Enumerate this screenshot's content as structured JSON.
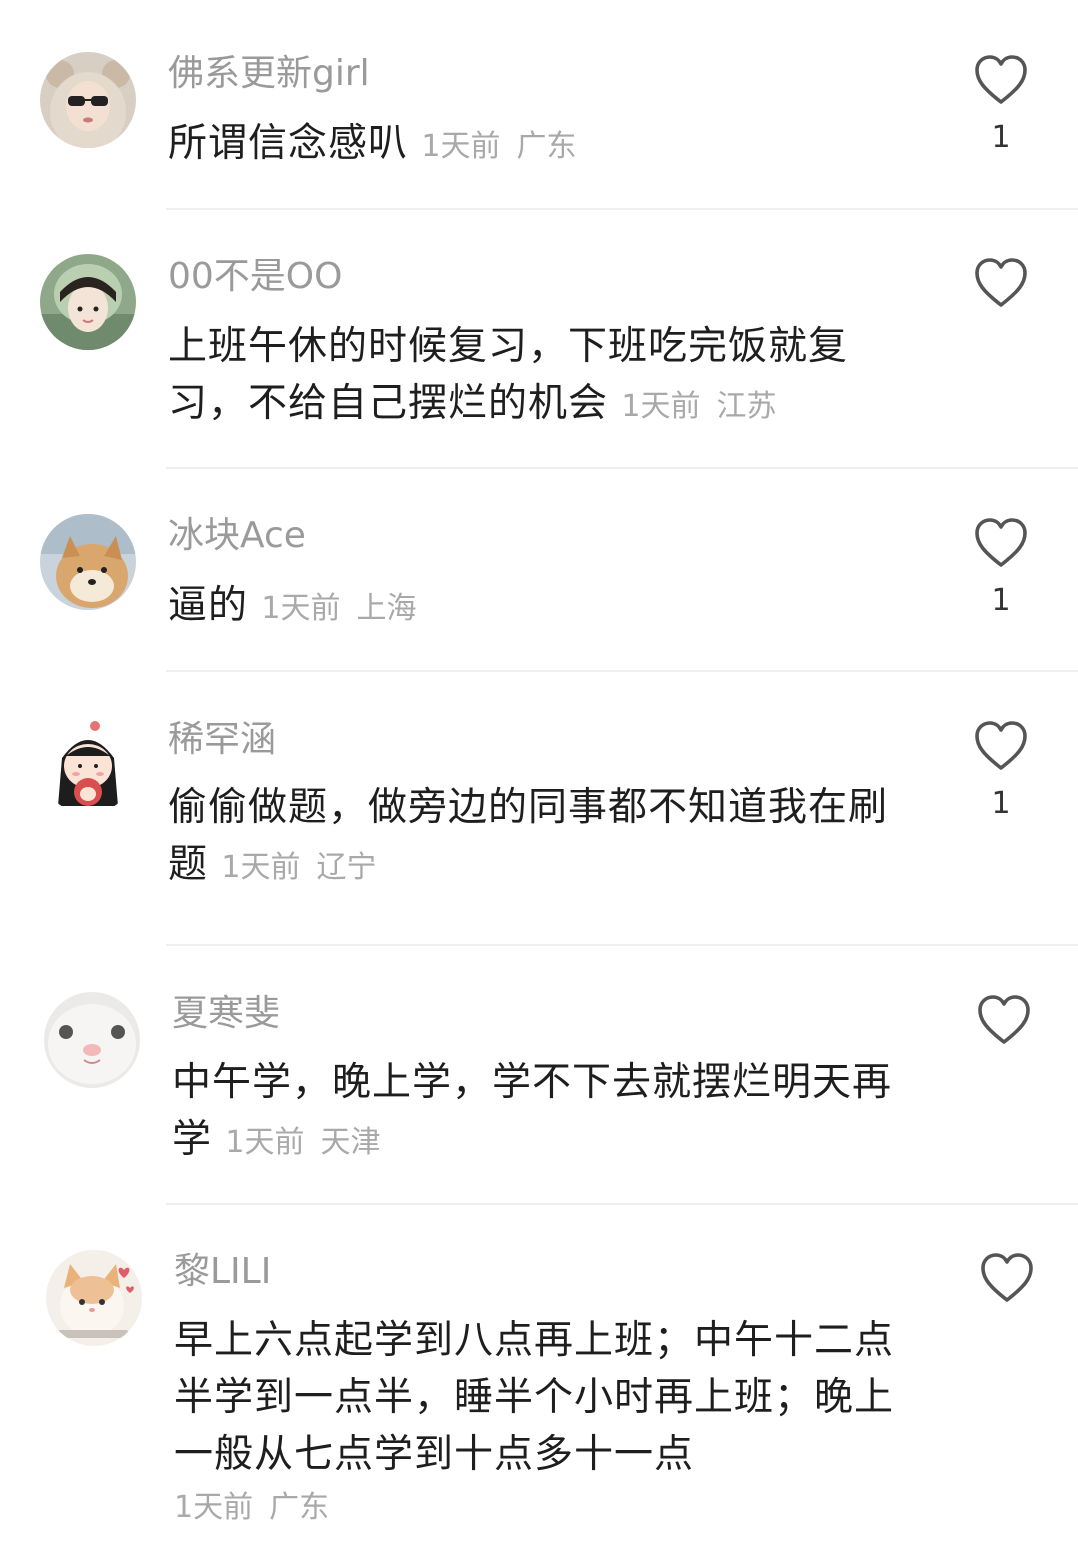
{
  "comments": [
    {
      "nickname": "佛系更新girl",
      "text": "所谓信念感叭",
      "time": "1天前",
      "location": "广东",
      "likes": "1",
      "avatar": "avatar-girl-bear-hood"
    },
    {
      "nickname": "00不是OO",
      "text": "上班午休的时候复习，下班吃完饭就复习，不给自己摆烂的机会",
      "time": "1天前",
      "location": "江苏",
      "likes": "",
      "avatar": "avatar-girl-headscarf"
    },
    {
      "nickname": "冰块Ace",
      "text": "逼的",
      "time": "1天前",
      "location": "上海",
      "likes": "1",
      "avatar": "avatar-shiba-dog"
    },
    {
      "nickname": "稀罕涵",
      "text": "偷偷做题，做旁边的同事都不知道我在刷题",
      "time": "1天前",
      "location": "辽宁",
      "likes": "1",
      "avatar": "avatar-cartoon-girl"
    },
    {
      "nickname": "夏寒斐",
      "text": "中午学，晚上学，学不下去就摆烂明天再学",
      "time": "1天前",
      "location": "天津",
      "likes": "",
      "avatar": "avatar-white-hamster"
    },
    {
      "nickname": "黎LILI",
      "text": "早上六点起学到八点再上班；中午十二点半学到一点半，睡半个小时再上班；晚上一般从七点学到十点多十一点",
      "time": "1天前",
      "location": "广东",
      "likes": "",
      "avatar": "avatar-kitten-hearts"
    }
  ],
  "icons": {
    "like": "heart-outline-icon"
  },
  "colors": {
    "nickname": "#9a9a9a",
    "text": "#1e1e1e",
    "meta": "#a9a9a9",
    "divider": "#efefef",
    "icon": "#555555"
  }
}
